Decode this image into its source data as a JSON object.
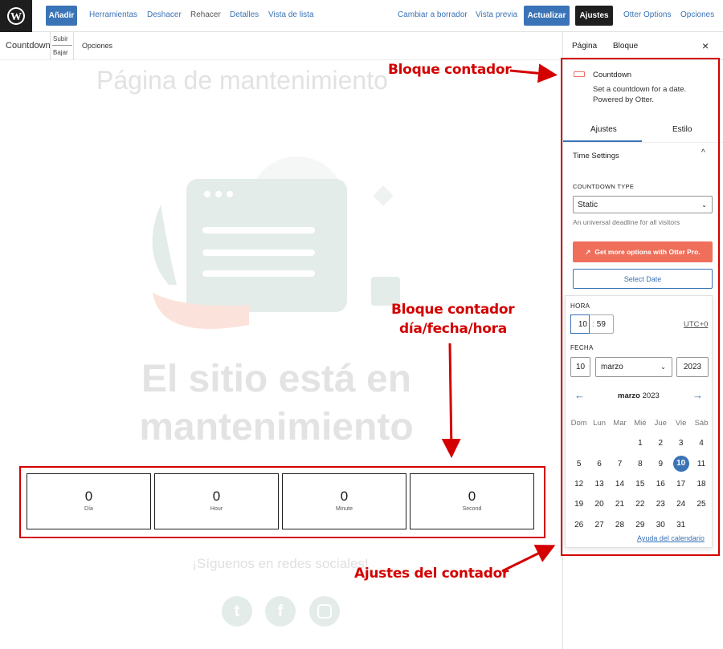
{
  "topbar": {
    "add": "Añadir",
    "tools": "Herramientas",
    "undo": "Deshacer",
    "redo": "Rehacer",
    "details": "Detalles",
    "list_view": "Vista de lista",
    "draft": "Cambiar a borrador",
    "preview": "Vista previa",
    "update": "Actualizar",
    "settings": "Ajustes",
    "otter": "Otter Options",
    "options": "Opciones"
  },
  "block_toolbar": {
    "block": "Countdown",
    "up": "Subir",
    "down": "Bajar",
    "options": "Opciones"
  },
  "canvas": {
    "title": "Página de mantenimiento",
    "heading_line1": "El sitio está en",
    "heading_line2": "mantenimiento",
    "social": "¡Síguenos en redes sociales!",
    "countdown": [
      {
        "value": "0",
        "label": "Día"
      },
      {
        "value": "0",
        "label": "Hour"
      },
      {
        "value": "0",
        "label": "Minute"
      },
      {
        "value": "0",
        "label": "Second"
      }
    ],
    "social_icons": [
      "twitter-icon",
      "facebook-icon",
      "instagram-icon"
    ]
  },
  "sidebar": {
    "tab_page": "Página",
    "tab_block": "Bloque",
    "block_name": "Countdown",
    "block_desc": "Set a countdown for a date. Powered by Otter.",
    "tab_settings": "Ajustes",
    "tab_style": "Estilo",
    "panel": "Time Settings",
    "type_label": "COUNTDOWN TYPE",
    "type_value": "Static",
    "type_help": "An universal deadline for all visitors",
    "pro": "Get more options with Otter Pro.",
    "select_date": "Select Date"
  },
  "picker": {
    "hour_label": "HORA",
    "hour": "10",
    "minute": "59",
    "sep": ":",
    "tz": "UTC+0",
    "date_label": "FECHA",
    "day": "10",
    "month": "marzo",
    "year": "2023",
    "month_title": "marzo",
    "year_title": "2023",
    "weekdays": [
      "Dom",
      "Lun",
      "Mar",
      "Mié",
      "Jue",
      "Vie",
      "Sáb"
    ],
    "weeks": [
      [
        "",
        "",
        "",
        "1",
        "2",
        "3",
        "4"
      ],
      [
        "5",
        "6",
        "7",
        "8",
        "9",
        "10",
        "11"
      ],
      [
        "12",
        "13",
        "14",
        "15",
        "16",
        "17",
        "18"
      ],
      [
        "19",
        "20",
        "21",
        "22",
        "23",
        "24",
        "25"
      ],
      [
        "26",
        "27",
        "28",
        "29",
        "30",
        "31",
        ""
      ]
    ],
    "selected": "10",
    "help": "Ayuda del calendario"
  },
  "annotations": {
    "a1": "Bloque contador",
    "a2_line1": "Bloque contador",
    "a2_line2": "día/fecha/hora",
    "a3": "Ajustes del contador"
  },
  "colors": {
    "accent": "#3a73b6",
    "pro": "#ef6f5b",
    "annotation": "#d40000"
  }
}
